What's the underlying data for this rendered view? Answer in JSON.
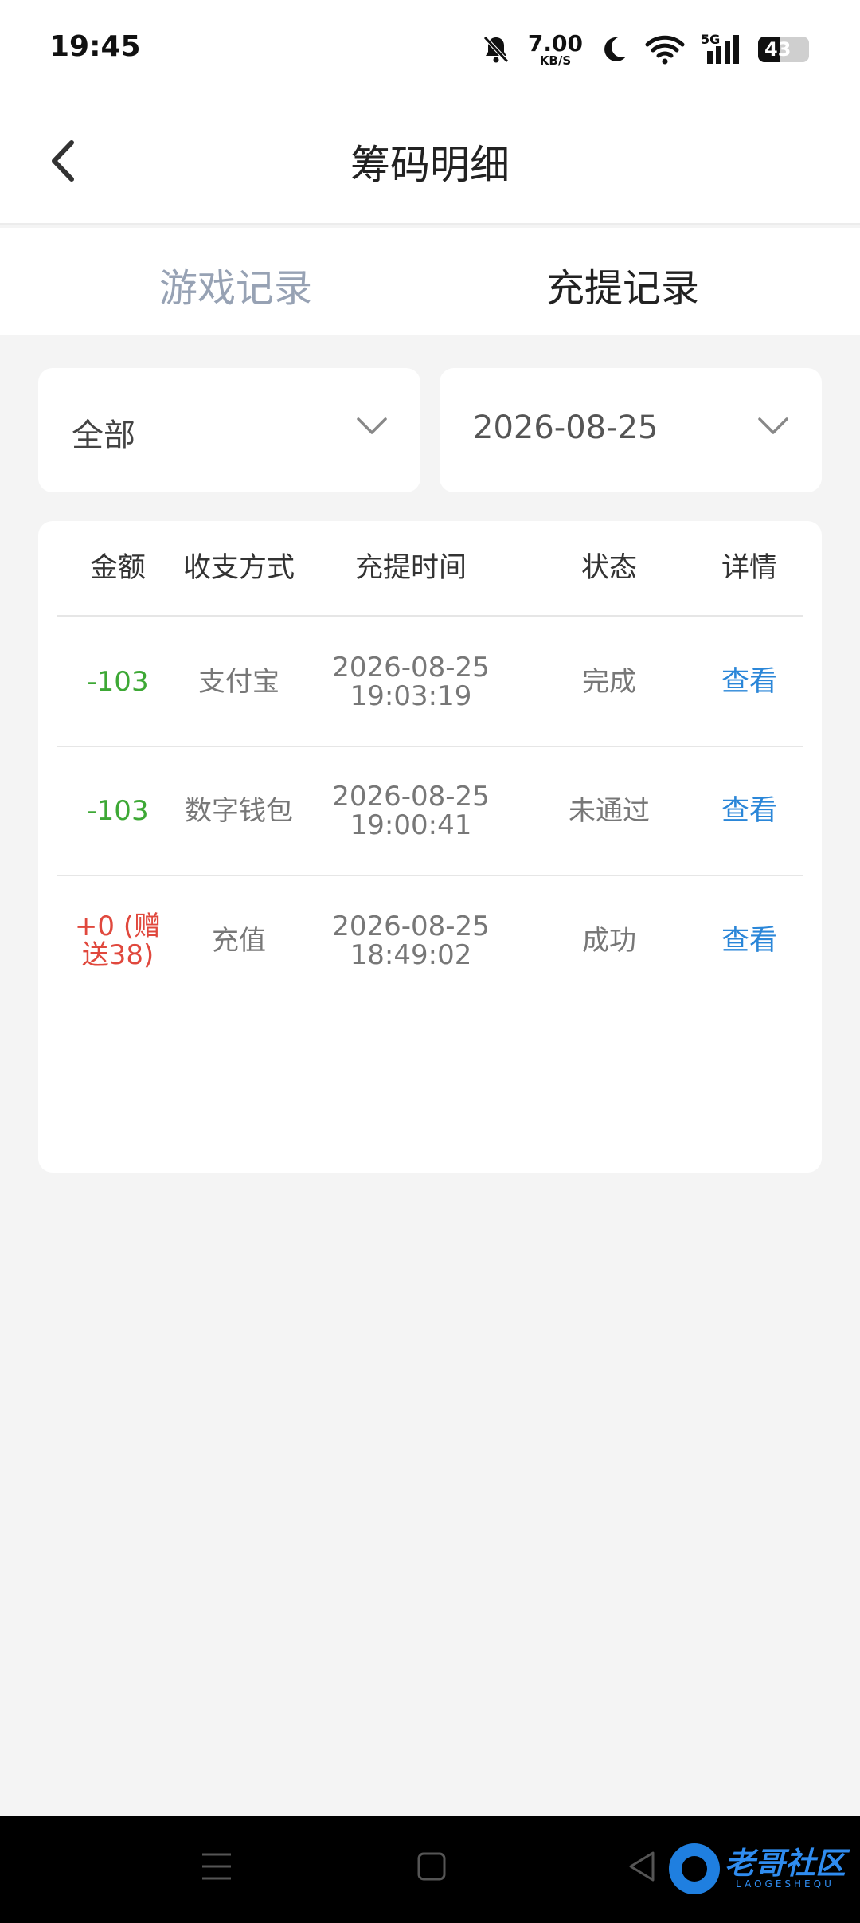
{
  "status_bar": {
    "time": "19:45",
    "net_speed_value": "7.00",
    "net_speed_unit": "KB/S",
    "network_type": "5G",
    "battery_level": "43",
    "battery_fraction": 0.43,
    "icons": [
      "mute-bell-icon",
      "moon-icon",
      "wifi-icon",
      "signal-icon",
      "battery-icon"
    ]
  },
  "header": {
    "title": "筹码明细",
    "back_icon": "chevron-left-icon"
  },
  "tabs": [
    {
      "label": "游戏记录",
      "active": false
    },
    {
      "label": "充提记录",
      "active": true
    }
  ],
  "filters": {
    "type_value": "全部",
    "date_value": "2026-08-25"
  },
  "table": {
    "headers": [
      "金额",
      "收支方式",
      "充提时间",
      "状态",
      "详情"
    ],
    "rows": [
      {
        "amount": "-103",
        "method": "支付宝",
        "date": "2026-08-25",
        "time": "19:03:19",
        "status": "完成",
        "action": "查看"
      },
      {
        "amount": "-103",
        "method": "数字钱包",
        "date": "2026-08-25",
        "time": "19:00:41",
        "status": "未通过",
        "action": "查看"
      },
      {
        "amount": "+0 (赠送38)",
        "method": "充值",
        "date": "2026-08-25",
        "time": "18:49:02",
        "status": "成功",
        "action": "查看"
      }
    ]
  },
  "colors": {
    "negative_amount": "#3da835",
    "positive_amount": "#e0483d",
    "link": "#2a86d8",
    "inactive_tab": "#97a2b4"
  },
  "watermark": {
    "text": "老哥社区",
    "sub": "LAOGESHEQU"
  }
}
